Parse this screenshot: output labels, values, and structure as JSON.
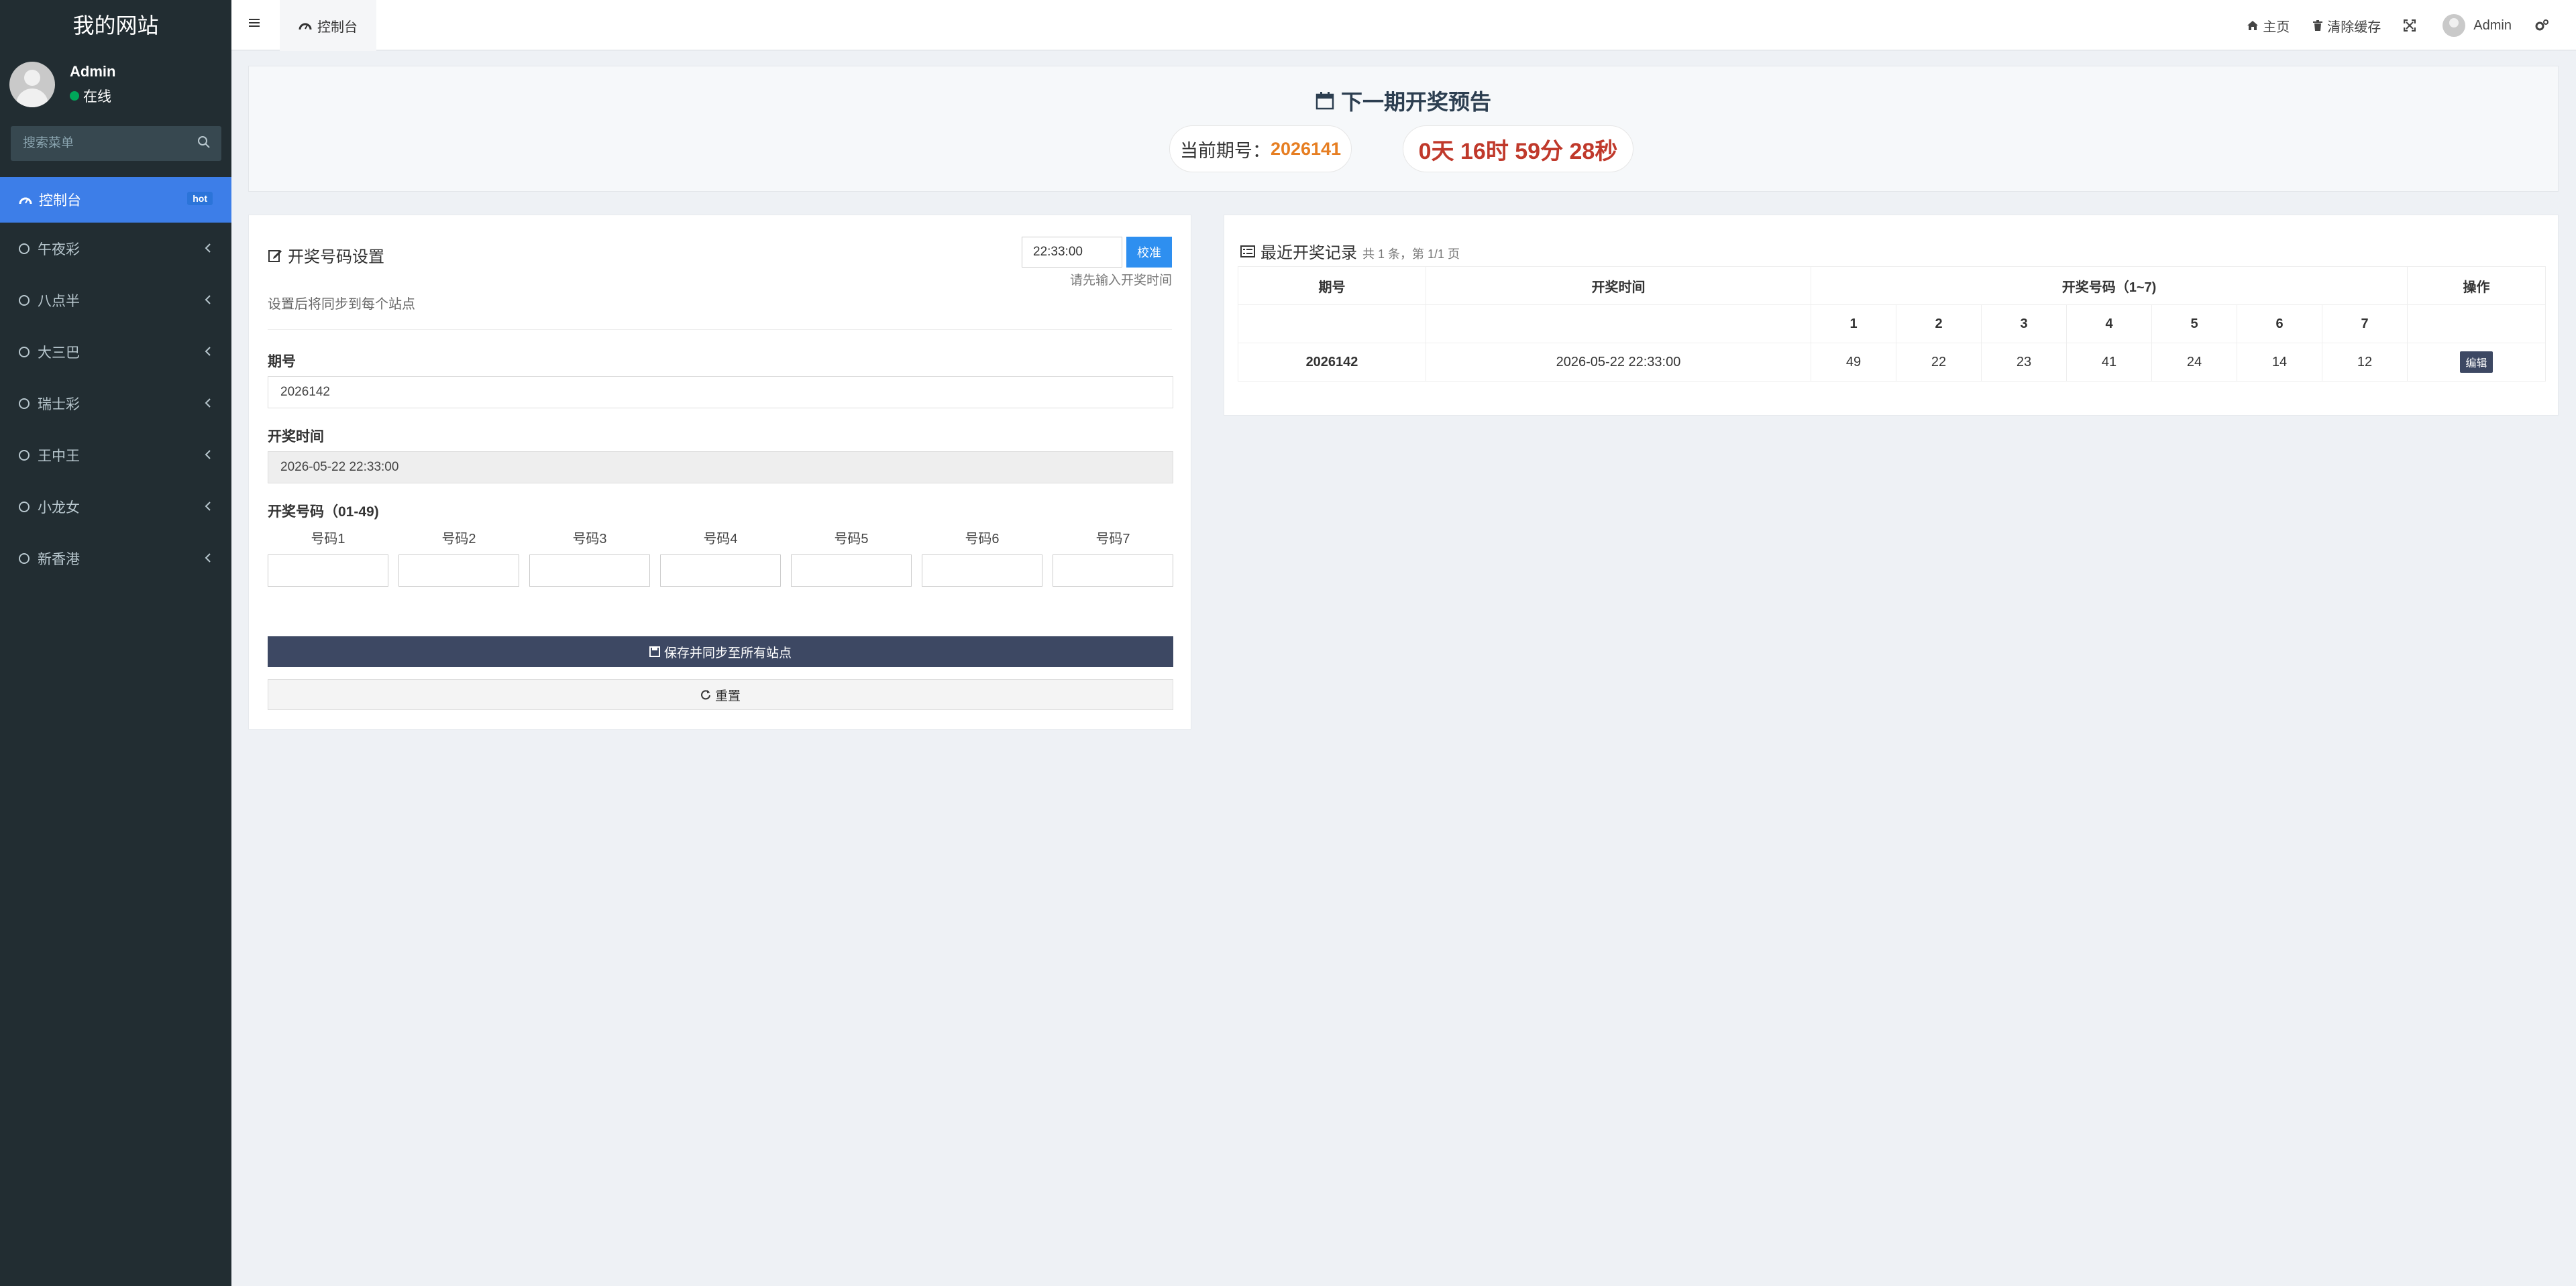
{
  "sidebar": {
    "site_title": "我的网站",
    "user_name": "Admin",
    "user_status": "在线",
    "search_placeholder": "搜索菜单",
    "items": [
      {
        "label": "控制台",
        "badge": "hot"
      },
      {
        "label": "午夜彩"
      },
      {
        "label": "八点半"
      },
      {
        "label": "大三巴"
      },
      {
        "label": "瑞士彩"
      },
      {
        "label": "王中王"
      },
      {
        "label": "小龙女"
      },
      {
        "label": "新香港"
      }
    ]
  },
  "topnav": {
    "tab_label": "控制台",
    "home_label": "主页",
    "clear_cache_label": "清除缓存",
    "user_label": "Admin"
  },
  "banner": {
    "title": "下一期开奖预告",
    "period_prefix": "当前期号：",
    "period": "2026141",
    "countdown": "0天 16时 59分 28秒"
  },
  "settings": {
    "title": "开奖号码设置",
    "time_value": "22:33:00",
    "check_label": "校准",
    "time_hint": "请先输入开奖时间",
    "subtitle": "设置后将同步到每个站点",
    "period_label": "期号",
    "period_value": "2026142",
    "time_label": "开奖时间",
    "draw_time_value": "2026-05-22 22:33:00",
    "codes_label": "开奖号码（01-49)",
    "code_labels": [
      "号码1",
      "号码2",
      "号码3",
      "号码4",
      "号码5",
      "号码6",
      "号码7"
    ],
    "save_label": "保存并同步至所有站点",
    "reset_label": "重置"
  },
  "records": {
    "title": "最近开奖记录",
    "summary": "共 1 条，第 1/1 页",
    "headers": {
      "period": "期号",
      "time": "开奖时间",
      "codes": "开奖号码（1~7)",
      "action": "操作"
    },
    "sub_headers": [
      "1",
      "2",
      "3",
      "4",
      "5",
      "6",
      "7"
    ],
    "rows": [
      {
        "period": "2026142",
        "time": "2026-05-22 22:33:00",
        "codes": [
          "49",
          "22",
          "23",
          "41",
          "24",
          "14",
          "12"
        ],
        "action": "编辑"
      }
    ]
  }
}
